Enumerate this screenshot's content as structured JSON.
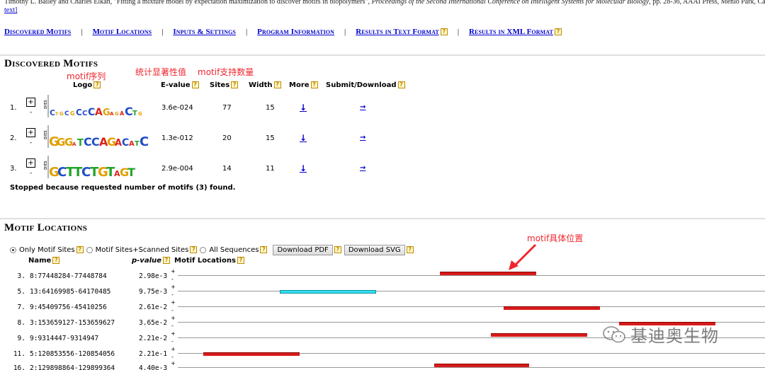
{
  "citation": {
    "authors": "Timothy L. Bailey and Charles Elkan, \"Fitting a mixture model by expectation maximization to discover motifs in biopolymers\",",
    "journal": "Proceedings of the Second International Conference on Intelligent Systems for Molecular Biology",
    "tail": ", pp. 28-36, AAAI Press, Menlo Park, Ca",
    "link": "text]"
  },
  "nav": {
    "items": [
      "Discovered Motifs",
      "Motif Locations",
      "Inputs & Settings",
      "Program Information",
      "Results in Text Format",
      "Results in XML Format"
    ],
    "separator": "|",
    "help": "?"
  },
  "discovered": {
    "title": "Discovered Motifs",
    "headers": {
      "logo": "Logo",
      "evalue": "E-value",
      "sites": "Sites",
      "width": "Width",
      "more": "More",
      "submit": "Submit/Download"
    },
    "motifs": [
      {
        "num": "1.",
        "expand": "+",
        "collapse": "-",
        "evalue": "3.6e-024",
        "sites": "77",
        "width": "15",
        "more": "↓",
        "submit": "→"
      },
      {
        "num": "2.",
        "expand": "+",
        "collapse": "-",
        "evalue": "1.3e-012",
        "sites": "20",
        "width": "15",
        "more": "↓",
        "submit": "→"
      },
      {
        "num": "3.",
        "expand": "+",
        "collapse": "-",
        "evalue": "2.9e-004",
        "sites": "14",
        "width": "11",
        "more": "↓",
        "submit": "→"
      }
    ],
    "stop_message": "Stopped because requested number of motifs (3) found."
  },
  "annotations": {
    "logo": "motif序列",
    "evalue": "统计显著性值",
    "sites": "motif支持数量",
    "locations": "motif具体位置"
  },
  "locations": {
    "title": "Motif Locations",
    "options": [
      "Only Motif Sites",
      "Motif Sites+Scanned Sites",
      "All Sequences"
    ],
    "selected_option": "Only Motif Sites",
    "buttons": {
      "pdf": "Download PDF",
      "svg": "Download SVG"
    },
    "headers": {
      "name": "Name",
      "pvalue": "p-value",
      "locations": "Motif Locations"
    },
    "strand_plus": "+",
    "strand_minus": "-",
    "rows": [
      {
        "idx": "3.",
        "name": "8:77448284-77448784",
        "pvalue": "2.98e-3"
      },
      {
        "idx": "5.",
        "name": "13:64169985-64170485",
        "pvalue": "9.75e-3"
      },
      {
        "idx": "7.",
        "name": "9:45409756-45410256",
        "pvalue": "2.61e-2"
      },
      {
        "idx": "8.",
        "name": "3:153659127-153659627",
        "pvalue": "3.65e-2"
      },
      {
        "idx": "9.",
        "name": "9:9314447-9314947",
        "pvalue": "2.21e-2"
      },
      {
        "idx": "11.",
        "name": "5:120853556-120854056",
        "pvalue": "2.21e-1"
      },
      {
        "idx": "16.",
        "name": "2:129898864-129899364",
        "pvalue": "4.40e-3"
      }
    ]
  },
  "colors": {
    "site_motif1": "#d81b1b",
    "site_motif2": "#33e0f0",
    "link": "#0000cc",
    "annotation": "#f0262e"
  },
  "watermark": "基迪奥生物"
}
